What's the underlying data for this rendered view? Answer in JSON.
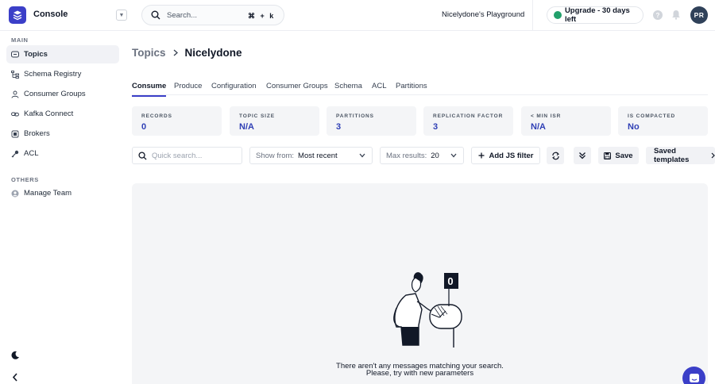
{
  "header": {
    "app_title": "Console",
    "search_placeholder": "Search...",
    "search_shortcut": "⌘ + k",
    "workspace_name": "Nicelydone's Playground",
    "upgrade_label": "Upgrade - 30 days left",
    "help_symbol": "?",
    "user_initials": "PR"
  },
  "sidebar": {
    "main_label": "MAIN",
    "items": [
      {
        "label": "Topics",
        "icon": "topics-icon",
        "active": true
      },
      {
        "label": "Schema Registry",
        "icon": "schema-icon",
        "active": false
      },
      {
        "label": "Consumer Groups",
        "icon": "consumer-groups-icon",
        "active": false
      },
      {
        "label": "Kafka Connect",
        "icon": "link-icon",
        "active": false
      },
      {
        "label": "Brokers",
        "icon": "broker-icon",
        "active": false
      },
      {
        "label": "ACL",
        "icon": "key-icon",
        "active": false
      }
    ],
    "others_label": "OTHERS",
    "others": [
      {
        "label": "Manage Team",
        "icon": "team-icon"
      }
    ]
  },
  "breadcrumb": {
    "parent": "Topics",
    "current": "Nicelydone"
  },
  "tabs": [
    {
      "label": "Consume",
      "active": true
    },
    {
      "label": "Produce",
      "active": false
    },
    {
      "label": "Configuration",
      "active": false
    },
    {
      "label": "Consumer Groups",
      "active": false
    },
    {
      "label": "Schema",
      "active": false
    },
    {
      "label": "ACL",
      "active": false
    },
    {
      "label": "Partitions",
      "active": false
    }
  ],
  "stats": [
    {
      "label": "Records",
      "value": "0"
    },
    {
      "label": "Topic size",
      "value": "N/A"
    },
    {
      "label": "Partitions",
      "value": "3"
    },
    {
      "label": "Replication factor",
      "value": "3"
    },
    {
      "label": "< Min ISR",
      "value": "N/A"
    },
    {
      "label": "Is compacted",
      "value": "No"
    }
  ],
  "filters": {
    "quick_search_placeholder": "Quick search...",
    "show_from_label": "Show from:",
    "show_from_value": "Most recent",
    "max_results_label": "Max results:",
    "max_results_value": "20",
    "add_filter_label": "Add JS filter",
    "save_label": "Save",
    "saved_templates_label": "Saved templates"
  },
  "empty_state": {
    "line1": "There aren't any messages matching your search.",
    "line2": "Please, try with new parameters",
    "illustration_badge": "0"
  },
  "colors": {
    "brand": "#3b3fc8",
    "stat_value": "#2f3fb5",
    "upgrade_dot": "#22a06b"
  }
}
